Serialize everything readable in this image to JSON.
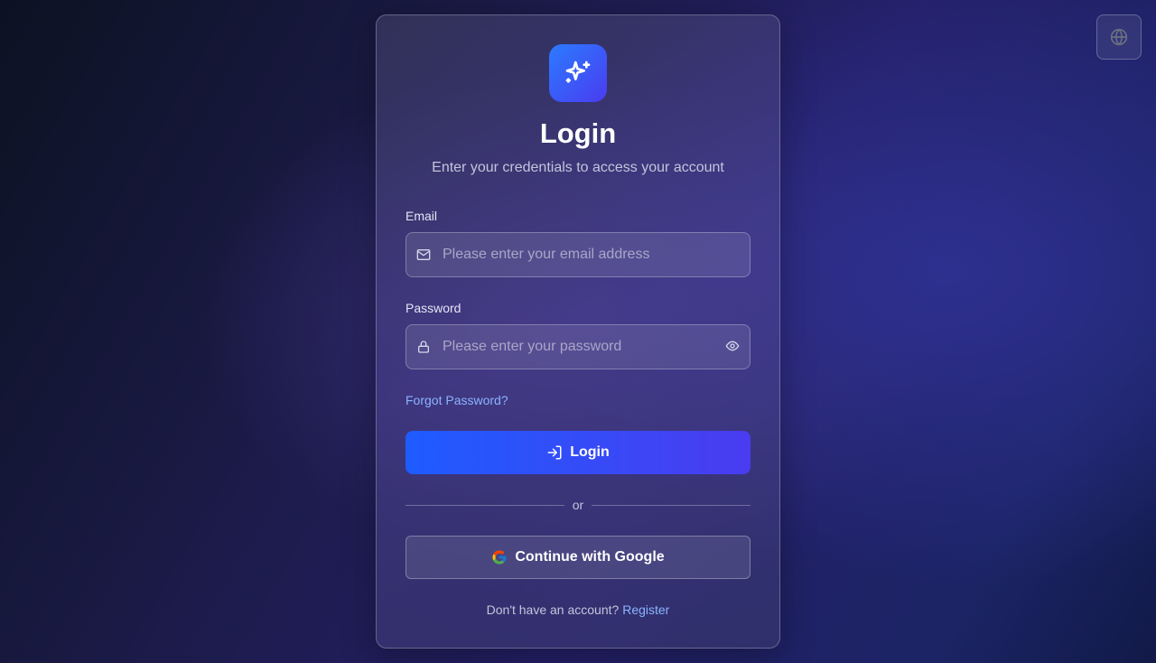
{
  "header": {
    "language_icon": "globe-icon"
  },
  "card": {
    "logo_icon": "sparkles-icon",
    "title": "Login",
    "subtitle": "Enter your credentials to access your account",
    "email": {
      "label": "Email",
      "placeholder": "Please enter your email address",
      "value": ""
    },
    "password": {
      "label": "Password",
      "placeholder": "Please enter your password",
      "value": ""
    },
    "forgot_password": "Forgot Password?",
    "login_button": "Login",
    "divider_text": "or",
    "google_button": "Continue with Google",
    "footer_text": "Don't have an account?",
    "register_link": "Register"
  },
  "colors": {
    "accent": "#1e5cff",
    "accent2": "#4a3cf0",
    "link": "#8ab4ff"
  }
}
